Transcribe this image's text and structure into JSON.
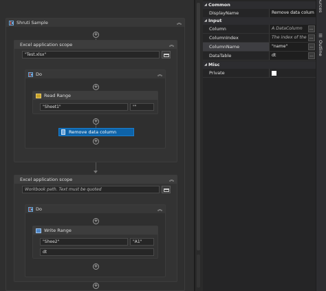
{
  "designer": {
    "sequence_title": "Shruti Sample",
    "scope1": {
      "title": "Excel application scope",
      "path_value": "\"Test.xlsx\"",
      "do_title": "Do",
      "read_range": {
        "title": "Read Range",
        "sheet": "\"Sheet1\"",
        "range": "\"\""
      },
      "selected_activity": "Remove data column"
    },
    "scope2": {
      "title": "Excel application scope",
      "path_placeholder": "Workbook path. Text must be quoted",
      "do_title": "Do",
      "write_range": {
        "title": "Write Range",
        "sheet": "\"Shee2\"",
        "start_cell": "\"A1\"",
        "datatable": "dt"
      }
    }
  },
  "properties": {
    "common": {
      "label": "Common",
      "rows": [
        {
          "name": "DisplayName",
          "value": "Remove data colum"
        }
      ]
    },
    "input": {
      "label": "Input",
      "rows": [
        {
          "name": "Column",
          "value": "A DataColumn"
        },
        {
          "name": "ColumnIndex",
          "value": "The index of the"
        },
        {
          "name": "ColumnName",
          "value": "\"name\""
        },
        {
          "name": "DataTable",
          "value": "dt"
        }
      ]
    },
    "misc": {
      "label": "Misc",
      "rows": [
        {
          "name": "Private",
          "value": ""
        }
      ]
    },
    "ellipsis": "..."
  },
  "side_tabs": {
    "resources": "Object Resources",
    "outline": "Outline"
  },
  "glyphs": {
    "plus": "+",
    "collapse": "︽",
    "tri_open": "◢"
  }
}
